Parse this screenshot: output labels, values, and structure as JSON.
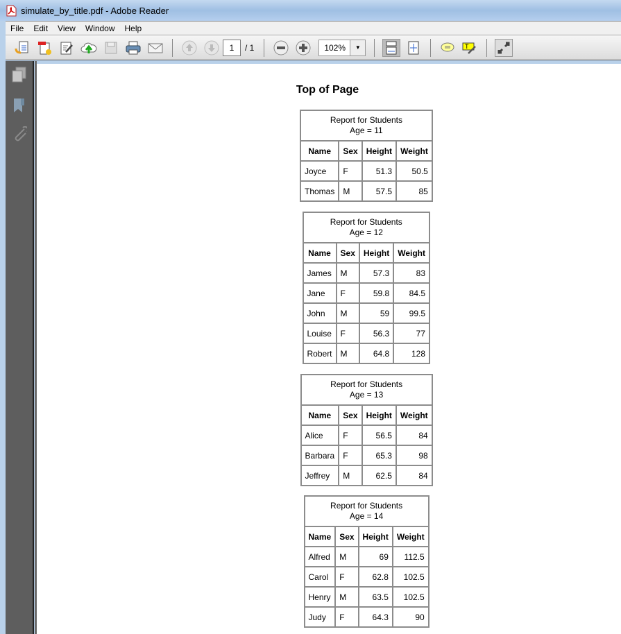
{
  "window": {
    "title": "simulate_by_title.pdf - Adobe Reader"
  },
  "menu": [
    "File",
    "Edit",
    "View",
    "Window",
    "Help"
  ],
  "toolbar": {
    "page_current": "1",
    "page_total": "/ 1",
    "zoom": "102%"
  },
  "document": {
    "title": "Top of Page",
    "columns": [
      "Name",
      "Sex",
      "Height",
      "Weight"
    ],
    "tables": [
      {
        "caption1": "Report for  Students",
        "caption2": "Age = 11",
        "rows": [
          [
            "Joyce",
            "F",
            "51.3",
            "50.5"
          ],
          [
            "Thomas",
            "M",
            "57.5",
            "85"
          ]
        ]
      },
      {
        "caption1": "Report for  Students",
        "caption2": "Age = 12",
        "rows": [
          [
            "James",
            "M",
            "57.3",
            "83"
          ],
          [
            "Jane",
            "F",
            "59.8",
            "84.5"
          ],
          [
            "John",
            "M",
            "59",
            "99.5"
          ],
          [
            "Louise",
            "F",
            "56.3",
            "77"
          ],
          [
            "Robert",
            "M",
            "64.8",
            "128"
          ]
        ]
      },
      {
        "caption1": "Report for  Students",
        "caption2": "Age = 13",
        "rows": [
          [
            "Alice",
            "F",
            "56.5",
            "84"
          ],
          [
            "Barbara",
            "F",
            "65.3",
            "98"
          ],
          [
            "Jeffrey",
            "M",
            "62.5",
            "84"
          ]
        ]
      },
      {
        "caption1": "Report for  Students",
        "caption2": "Age = 14",
        "rows": [
          [
            "Alfred",
            "M",
            "69",
            "112.5"
          ],
          [
            "Carol",
            "F",
            "62.8",
            "102.5"
          ],
          [
            "Henry",
            "M",
            "63.5",
            "102.5"
          ],
          [
            "Judy",
            "F",
            "64.3",
            "90"
          ]
        ]
      }
    ]
  }
}
